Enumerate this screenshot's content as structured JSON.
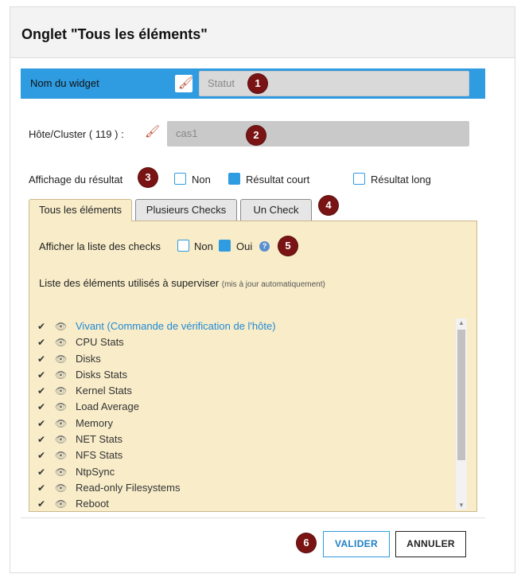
{
  "header": {
    "title": "Onglet \"Tous les éléments\""
  },
  "widget": {
    "label": "Nom du widget",
    "value": "Statut",
    "badge": "1",
    "icon": "brush-icon"
  },
  "host": {
    "label": "Hôte/Cluster ( 119 ) :",
    "value": "cas1",
    "badge": "2",
    "icon": "brush-icon"
  },
  "display": {
    "label": "Affichage du résultat",
    "badge": "3",
    "options": [
      {
        "label": "Non",
        "checked": false
      },
      {
        "label": "Résultat court",
        "checked": true
      },
      {
        "label": "Résultat long",
        "checked": false
      }
    ]
  },
  "tabs": {
    "badge": "4",
    "items": [
      {
        "label": "Tous les éléments",
        "active": true
      },
      {
        "label": "Plusieurs Checks",
        "active": false
      },
      {
        "label": "Un Check",
        "active": false
      }
    ]
  },
  "checks_list": {
    "label": "Afficher la liste des checks",
    "badge": "5",
    "no_label": "Non",
    "yes_label": "Oui",
    "yes_checked": true,
    "info_icon": "?"
  },
  "elements": {
    "title": "Liste des éléments utilisés à superviser",
    "subtitle": "(mis à jour automatiquement)",
    "items": [
      {
        "name": "Vivant (Commande de vérification de l'hôte)",
        "highlight": true
      },
      {
        "name": "CPU Stats"
      },
      {
        "name": "Disks"
      },
      {
        "name": "Disks Stats"
      },
      {
        "name": "Kernel Stats"
      },
      {
        "name": "Load Average"
      },
      {
        "name": "Memory"
      },
      {
        "name": "NET Stats"
      },
      {
        "name": "NFS Stats"
      },
      {
        "name": "NtpSync"
      },
      {
        "name": "Read-only Filesystems"
      },
      {
        "name": "Reboot"
      }
    ]
  },
  "footer": {
    "badge": "6",
    "valider": "VALIDER",
    "annuler": "ANNULER"
  },
  "colors": {
    "accent": "#2f9be0",
    "badge": "#7a1414",
    "panel": "#f8ecc9"
  }
}
